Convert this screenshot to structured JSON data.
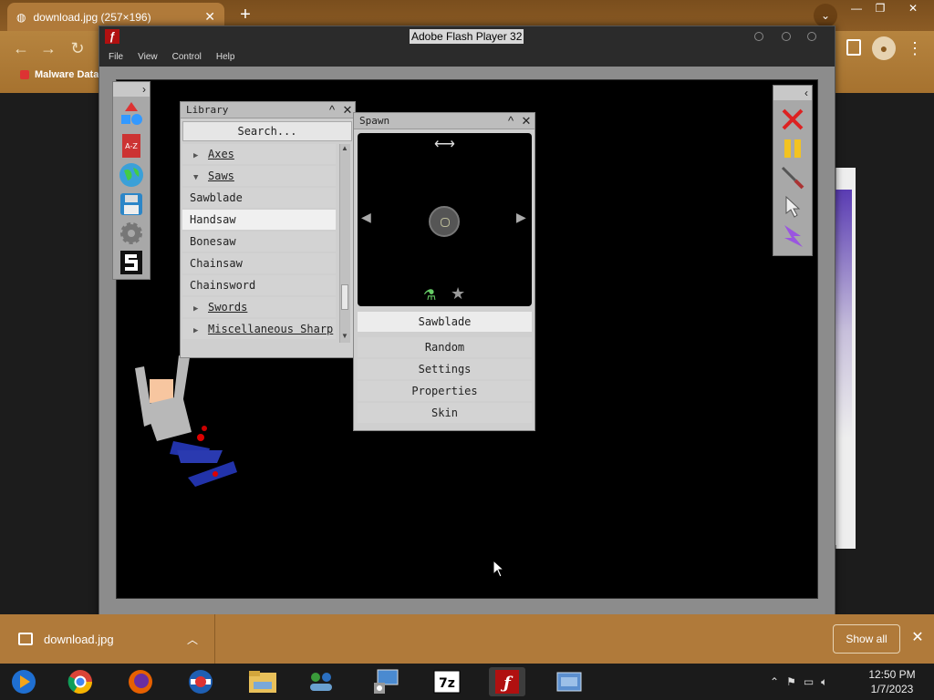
{
  "browser": {
    "tab_title": "download.jpg (257×196)",
    "tab_close": "✕",
    "new_tab": "+",
    "bookmark": "Malware Data",
    "window_controls": [
      "—",
      "❐",
      "✕"
    ]
  },
  "flash": {
    "title": "Adobe Flash Player 32",
    "logo": "ƒ",
    "menu": [
      "File",
      "View",
      "Control",
      "Help"
    ]
  },
  "library": {
    "title": "Library",
    "search_placeholder": "Search...",
    "rows": [
      {
        "type": "cat",
        "label": "Axes",
        "expanded": false
      },
      {
        "type": "cat",
        "label": "Saws",
        "expanded": true
      },
      {
        "type": "item",
        "label": "Sawblade"
      },
      {
        "type": "item",
        "label": "Handsaw",
        "selected": true
      },
      {
        "type": "item",
        "label": "Bonesaw"
      },
      {
        "type": "item",
        "label": "Chainsaw"
      },
      {
        "type": "item",
        "label": "Chainsword"
      },
      {
        "type": "cat",
        "label": "Swords",
        "expanded": false
      },
      {
        "type": "cat",
        "label": "Miscellaneous Sharp",
        "expanded": false
      }
    ]
  },
  "spawn": {
    "title": "Spawn",
    "selected": "Sawblade",
    "options": [
      "Random",
      "Settings",
      "Properties",
      "Skin"
    ],
    "resize_arrow": "⟷",
    "prev_arrow": "◀",
    "next_arrow": "▶"
  },
  "download_shelf": {
    "filename": "download.jpg",
    "show_all": "Show all",
    "close": "✕"
  },
  "taskbar": {
    "time": "12:50 PM",
    "date": "1/7/2023",
    "icons": [
      "windows-media-icon",
      "chrome-icon",
      "firefox-icon",
      "opera-icon",
      "file-explorer-icon",
      "network-people-icon",
      "remote-desktop-icon",
      "7zip-icon",
      "flash-player-icon",
      "app-window-icon"
    ]
  },
  "colors": {
    "stage": "#000000",
    "panel": "#cfcfcf",
    "browser_accent": "#b07a3a"
  }
}
